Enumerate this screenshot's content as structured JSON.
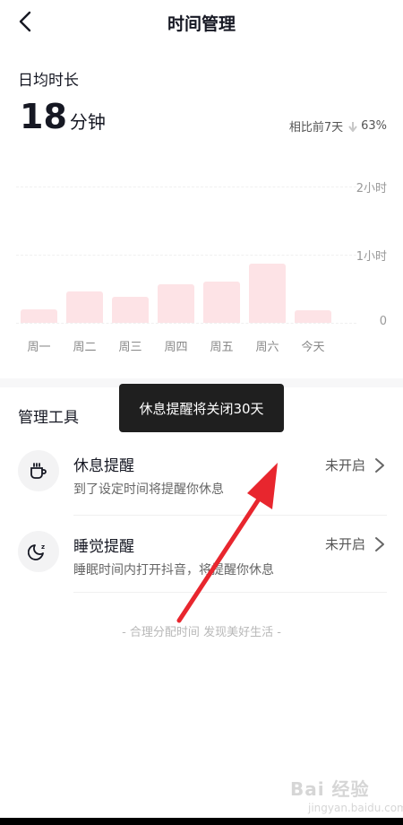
{
  "header": {
    "title": "时间管理",
    "back_icon": "back-arrow-icon"
  },
  "daily": {
    "label": "日均时长",
    "value": "18",
    "unit": "分钟"
  },
  "compare": {
    "label": "相比前7天",
    "direction_icon": "down-arrow-icon",
    "percent": "63%"
  },
  "chart_data": {
    "type": "bar",
    "categories": [
      "周一",
      "周二",
      "周三",
      "周四",
      "周五",
      "周六",
      "今天"
    ],
    "values": [
      12,
      28,
      23,
      34,
      36,
      52,
      11
    ],
    "y_tick_labels": [
      "2小时",
      "1小时",
      "0"
    ],
    "ylim": [
      0,
      120
    ],
    "bar_color": "#fde3e6"
  },
  "tools": {
    "label": "管理工具",
    "items": [
      {
        "title": "休息提醒",
        "desc": "到了设定时间将提醒你休息",
        "status": "未开启",
        "icon": "coffee-cup-icon"
      },
      {
        "title": "睡觉提醒",
        "desc": "睡眠时间内打开抖音，将提醒你休息",
        "status": "未开启",
        "icon": "moon-sleep-icon"
      }
    ]
  },
  "footer": {
    "note": "- 合理分配时间 发现美好生活 -"
  },
  "toast": {
    "text": "休息提醒将关闭30天"
  },
  "watermark": {
    "text": "Bai 经验",
    "sub": "jingyan.baidu.com"
  },
  "colors": {
    "annotation_arrow": "#e8262e",
    "toast_bg": "#1f1f1f"
  }
}
